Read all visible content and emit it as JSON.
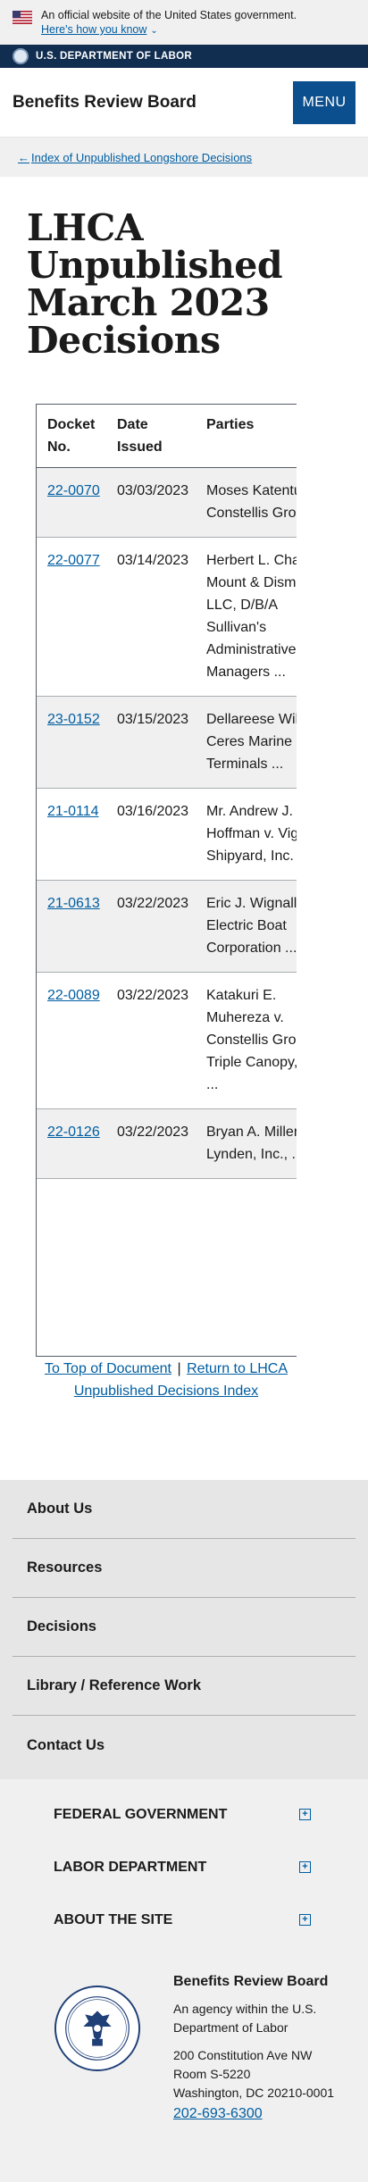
{
  "gov_banner": {
    "text": "An official website of the United States government.",
    "link": "Here's how you know"
  },
  "dol_bar": {
    "text": "U.S. DEPARTMENT OF LABOR"
  },
  "header": {
    "title": "Benefits Review Board",
    "menu_label": "MENU"
  },
  "breadcrumb": {
    "link": "Index of Unpublished Longshore Decisions"
  },
  "page": {
    "title": "LHCA Unpublished March 2023 Decisions"
  },
  "table": {
    "headers": [
      "Docket No.",
      "Date Issued",
      "Parties"
    ],
    "rows": [
      {
        "docket": "22-0070",
        "date": "03/03/2023",
        "parties": "Moses Katenture v. Constellis Group ..."
      },
      {
        "docket": "22-0077",
        "date": "03/14/2023",
        "parties": "Herbert L. Chaplin v. Mount & Dismount, LLC, D/B/A Sullivan's Administrative Managers ..."
      },
      {
        "docket": "23-0152",
        "date": "03/15/2023",
        "parties": "Dellareese Wilson v. Ceres Marine Terminals ..."
      },
      {
        "docket": "21-0114",
        "date": "03/16/2023",
        "parties": "Mr. Andrew J. Hoffman v. Vigor Shipyard, Inc. ..."
      },
      {
        "docket": "21-0613",
        "date": "03/22/2023",
        "parties": "Eric J. Wignall v. Electric Boat Corporation ..."
      },
      {
        "docket": "22-0089",
        "date": "03/22/2023",
        "parties": "Katakuri E. Muhereza v. Constellis Group/ Triple Canopy, Inc., ..."
      },
      {
        "docket": "22-0126",
        "date": "03/22/2023",
        "parties": "Bryan A. Miller v. Lynden, Inc., ..."
      }
    ]
  },
  "links": {
    "top": "To Top of Document",
    "separator": "|",
    "return": "Return to LHCA Unpublished Decisions Index"
  },
  "footer_nav": [
    "About Us",
    "Resources",
    "Decisions",
    "Library / Reference Work",
    "Contact Us"
  ],
  "footer_accordions": [
    "FEDERAL GOVERNMENT",
    "LABOR DEPARTMENT",
    "ABOUT THE SITE"
  ],
  "footer_info": {
    "title": "Benefits Review Board",
    "agency": "An agency within the U.S. Department of Labor",
    "address1": "200 Constitution Ave NW",
    "address2": "Room S-5220",
    "address3": "Washington, DC 20210-0001",
    "phone": "202-693-6300"
  },
  "colors": {
    "link": "#005ea2",
    "navy": "#112e51",
    "menu": "#0b4f8e"
  },
  "icons": [
    "us-flag-icon",
    "chevron-down-icon",
    "dol-seal-icon",
    "arrow-left-icon",
    "plus-icon",
    "dol-seal-large-icon"
  ]
}
